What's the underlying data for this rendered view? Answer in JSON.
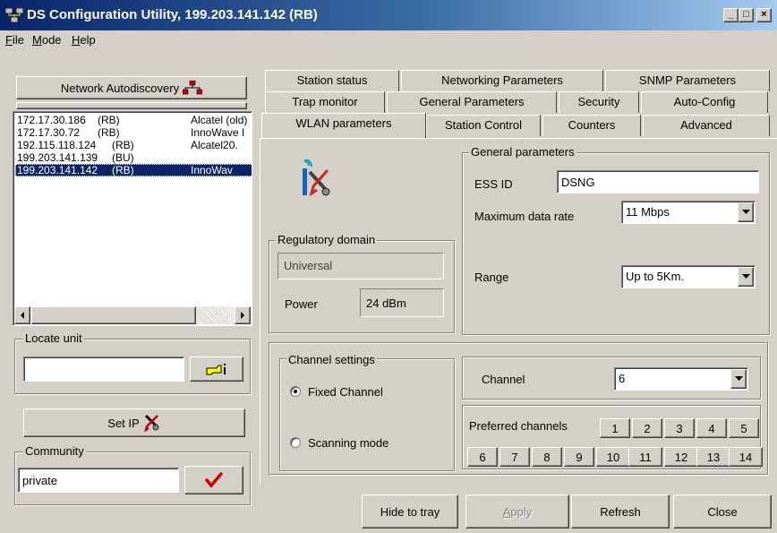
{
  "window": {
    "title": "DS Configuration Utility, 199.203.141.142  (RB)",
    "controls": {
      "minimize": "_",
      "maximize": "□",
      "close": "×"
    }
  },
  "menu": [
    {
      "label": "File",
      "underline": "F"
    },
    {
      "label": "Mode",
      "underline": "M"
    },
    {
      "label": "Help",
      "underline": "H"
    }
  ],
  "left": {
    "autodiscovery_label": "Network Autodiscovery",
    "devices": [
      {
        "ip": "172.17.30.186",
        "type": "(RB)",
        "name": "Alcatel (old)"
      },
      {
        "ip": "172.17.30.72",
        "type": "(RB)",
        "name": "InnoWave I"
      },
      {
        "ip": "192.115.118.124",
        "type": "(RB)",
        "name": "Alcatel20."
      },
      {
        "ip": "199.203.141.139",
        "type": "(BU)",
        "name": ""
      },
      {
        "ip": "199.203.141.142",
        "type": "(RB)",
        "name": "InnoWav"
      }
    ],
    "selected_index": 4,
    "locate_label": "Locate unit",
    "locate_value": "",
    "set_ip_label": "Set IP",
    "community_label": "Community",
    "community_value": "private"
  },
  "tabs": {
    "row1": [
      "Station status",
      "Networking Parameters",
      "SNMP Parameters"
    ],
    "row2": [
      "Trap monitor",
      "General Parameters",
      "Security",
      "Auto-Config"
    ],
    "row3": [
      "WLAN parameters",
      "Station Control",
      "Counters",
      "Advanced"
    ],
    "active": "WLAN parameters"
  },
  "general": {
    "group_label": "General parameters",
    "essid_label": "ESS ID",
    "essid_value": "DSNG",
    "maxrate_label": "Maximum data rate",
    "maxrate_value": "11 Mbps",
    "range_label": "Range",
    "range_value": "Up to 5Km."
  },
  "regulatory": {
    "group_label": "Regulatory domain",
    "domain_value": "Universal",
    "power_label": "Power",
    "power_value": "24 dBm"
  },
  "channel": {
    "group_label": "Channel settings",
    "fixed_label": "Fixed Channel",
    "scanning_label": "Scanning mode",
    "mode": "fixed",
    "channel_label": "Channel",
    "channel_value": "6",
    "preferred_label": "Preferred channels",
    "preferred_row1": [
      "1",
      "2",
      "3",
      "4",
      "5"
    ],
    "preferred_row2": [
      "6",
      "7",
      "8",
      "9",
      "10",
      "11",
      "12",
      "13",
      "14"
    ]
  },
  "buttons": {
    "hide_to_tray": "Hide to tray",
    "apply": "Apply",
    "apply_underline": "A",
    "refresh": "Refresh",
    "close": "Close"
  },
  "colors": {
    "face": "#d4d0c8",
    "selection": "#0a246a",
    "checkmark": "#d40000"
  }
}
